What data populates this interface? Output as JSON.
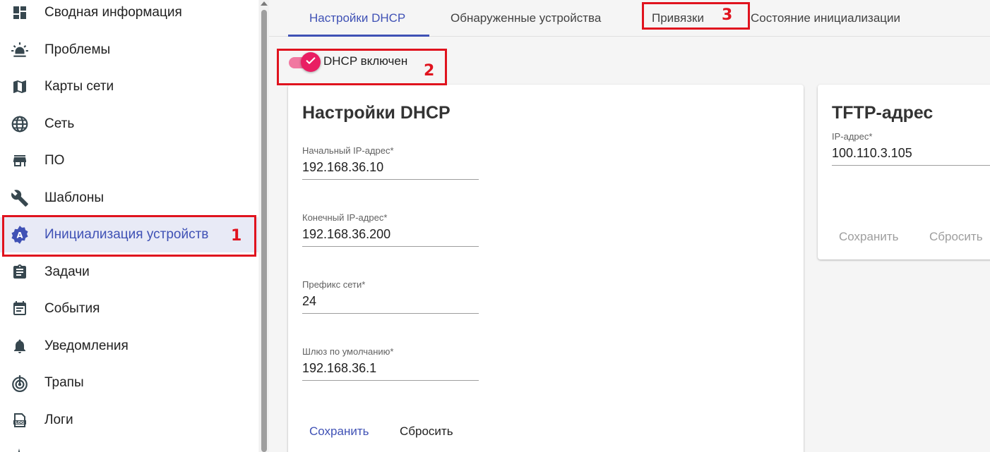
{
  "sidebar": {
    "items": [
      {
        "label": "Сводная информация",
        "icon": "dashboard-icon"
      },
      {
        "label": "Проблемы",
        "icon": "alarm-light-icon"
      },
      {
        "label": "Карты сети",
        "icon": "map-icon"
      },
      {
        "label": "Сеть",
        "icon": "globe-icon"
      },
      {
        "label": "ПО",
        "icon": "store-icon"
      },
      {
        "label": "Шаблоны",
        "icon": "wrench-icon"
      },
      {
        "label": "Инициализация устройств",
        "icon": "auto-fix-badge-icon",
        "active": true
      },
      {
        "label": "Задачи",
        "icon": "clipboard-icon"
      },
      {
        "label": "События",
        "icon": "calendar-icon"
      },
      {
        "label": "Уведомления",
        "icon": "bell-icon"
      },
      {
        "label": "Трапы",
        "icon": "trap-signal-icon"
      },
      {
        "label": "Логи",
        "icon": "log-file-icon"
      }
    ]
  },
  "tabs": [
    {
      "label": "Настройки DHCP",
      "active": true
    },
    {
      "label": "Обнаруженные устройства"
    },
    {
      "label": "Привязки"
    },
    {
      "label": "Состояние инициализации"
    }
  ],
  "dhcp_toggle": {
    "label": "DHCP включен",
    "enabled": true
  },
  "dhcp_card": {
    "title": "Настройки DHCP",
    "fields": [
      {
        "label": "Начальный IP-адрес*",
        "value": "192.168.36.10"
      },
      {
        "label": "Конечный IP-адрес*",
        "value": "192.168.36.200"
      },
      {
        "label": "Префикс сети*",
        "value": "24"
      },
      {
        "label": "Шлюз по умолчанию*",
        "value": "192.168.36.1"
      }
    ],
    "save_label": "Сохранить",
    "reset_label": "Сбросить"
  },
  "tftp_card": {
    "title": "TFTP-адрес",
    "field": {
      "label": "IP-адрес*",
      "value": "100.110.3.105"
    },
    "save_label": "Сохранить",
    "reset_label": "Сбросить"
  },
  "annotations": [
    "1",
    "2",
    "3"
  ],
  "colors": {
    "accent": "#3f51b5",
    "toggle": "#e91e63",
    "annotation": "#e0131e"
  }
}
